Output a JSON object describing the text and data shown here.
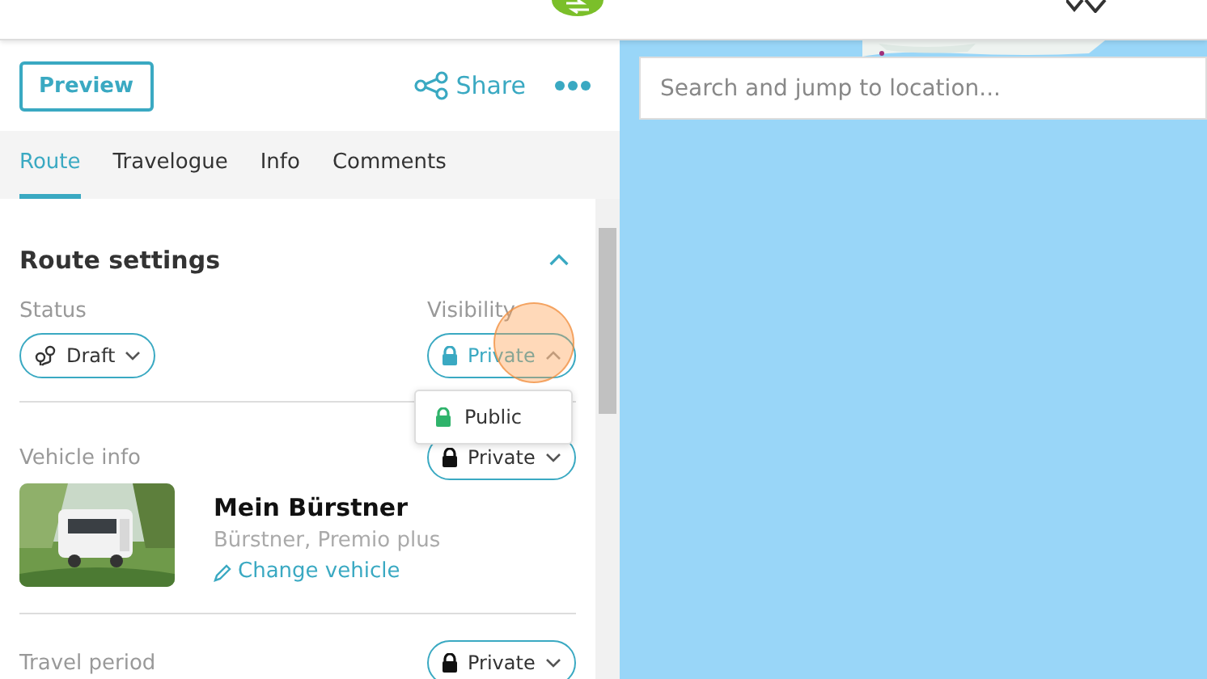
{
  "header": {
    "preview": "Preview",
    "share": "Share"
  },
  "tabs": [
    {
      "label": "Route",
      "selected": true
    },
    {
      "label": "Travelogue",
      "selected": false
    },
    {
      "label": "Info",
      "selected": false
    },
    {
      "label": "Comments",
      "selected": false
    }
  ],
  "section": {
    "title": "Route settings",
    "expanded": true,
    "status": {
      "label": "Status",
      "value": "Draft"
    },
    "visibility": {
      "label": "Visibility",
      "value": "Private",
      "open": true,
      "options": [
        {
          "label": "Public"
        }
      ]
    }
  },
  "vehicle": {
    "label": "Vehicle info",
    "visibility": "Private",
    "name": "Mein Bürstner",
    "model": "Bürstner, Premio plus",
    "change": "Change vehicle"
  },
  "travel": {
    "label": "Travel period",
    "visibility": "Private"
  },
  "map": {
    "search_placeholder": "Search and jump to location..."
  }
}
